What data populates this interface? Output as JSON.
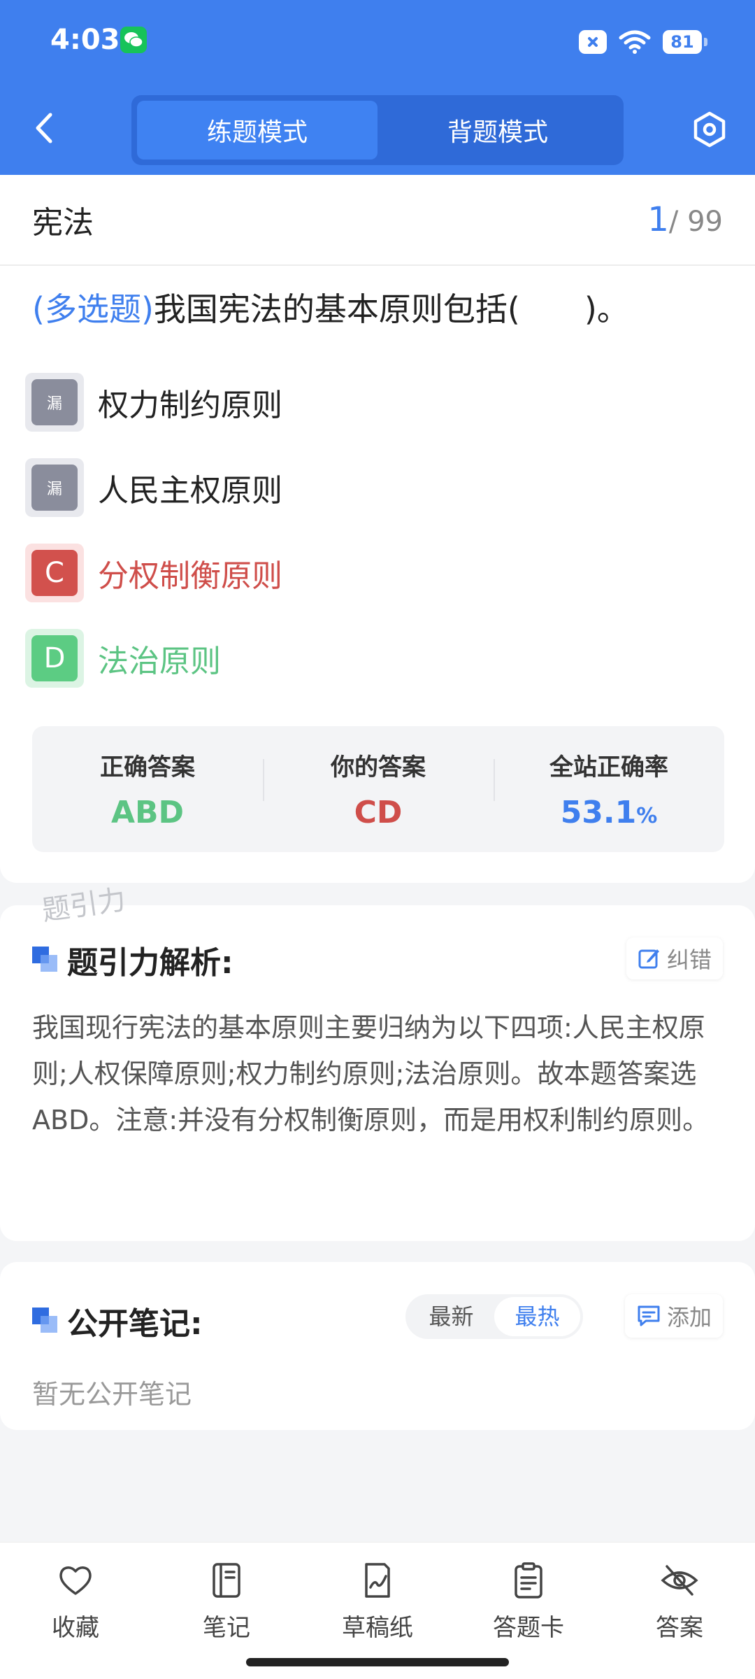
{
  "status_bar": {
    "time": "4:03",
    "battery": "81"
  },
  "header": {
    "modes": [
      "练题模式",
      "背题模式"
    ],
    "active_mode": 0
  },
  "question": {
    "subject": "宪法",
    "current": "1",
    "total": "/ 99",
    "type_label": "(多选题)",
    "text": "我国宪法的基本原则包括(　　)。",
    "options": [
      {
        "badge": "漏",
        "text": "权力制约原则",
        "state": "missed"
      },
      {
        "badge": "漏",
        "text": "人民主权原则",
        "state": "missed"
      },
      {
        "badge": "C",
        "text": "分权制衡原则",
        "state": "wrong"
      },
      {
        "badge": "D",
        "text": "法治原则",
        "state": "correct"
      }
    ]
  },
  "stats": {
    "correct_label": "正确答案",
    "correct_value": "ABD",
    "yours_label": "你的答案",
    "yours_value": "CD",
    "rate_label": "全站正确率",
    "rate_value": "53.1",
    "rate_unit": "%"
  },
  "watermark": "题引力",
  "analysis": {
    "title": "题引力解析:",
    "correct_btn": "纠错",
    "text": "我国现行宪法的基本原则主要归纳为以下四项:人民主权原则;人权保障原则;权力制约原则;法治原则。故本题答案选ABD。注意:并没有分权制衡原则，而是用权利制约原则。"
  },
  "notes": {
    "title": "公开笔记:",
    "sort_options": [
      "最新",
      "最热"
    ],
    "active_sort": 1,
    "add_btn": "添加",
    "empty_text": "暂无公开笔记"
  },
  "bottom_nav": [
    {
      "label": "收藏",
      "icon": "heart-icon"
    },
    {
      "label": "笔记",
      "icon": "notebook-icon"
    },
    {
      "label": "草稿纸",
      "icon": "draft-icon"
    },
    {
      "label": "答题卡",
      "icon": "answer-card-icon"
    },
    {
      "label": "答案",
      "icon": "eye-off-icon"
    }
  ],
  "colors": {
    "brand": "#3f7fee",
    "wrong": "#cf4e4a",
    "correct": "#5cc483",
    "missed": "#8a8d9c"
  }
}
